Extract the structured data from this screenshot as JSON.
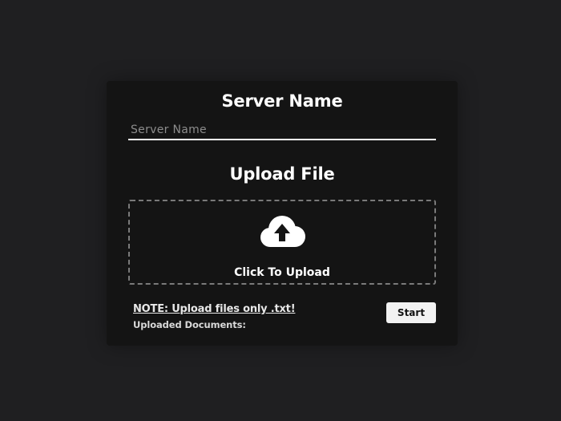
{
  "server": {
    "title": "Server Name",
    "input_placeholder": "Server Name",
    "input_value": ""
  },
  "upload": {
    "title": "Upload File",
    "dropzone_label": "Click To Upload",
    "icon": "cloud-upload-icon"
  },
  "footer": {
    "note": "NOTE: Upload files only .txt!",
    "uploaded_label": "Uploaded Documents:",
    "start_label": "Start"
  },
  "colors": {
    "page_background": "#1f1f21",
    "card_background": "#141414",
    "text": "#ffffff",
    "dropzone_border": "#7a7a7a",
    "button_background": "#f2f2f2"
  }
}
